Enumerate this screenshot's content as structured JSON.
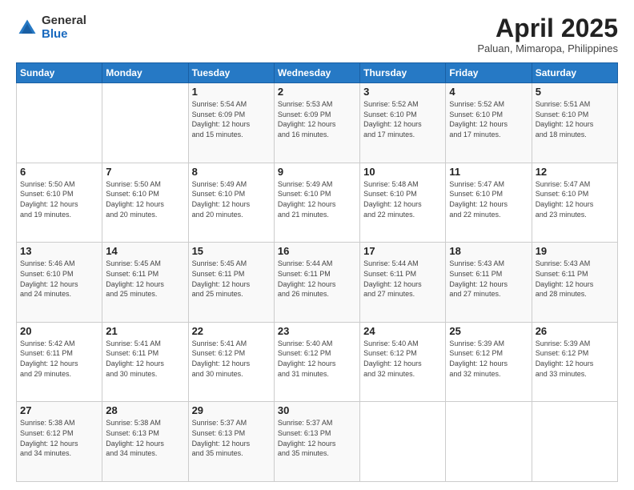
{
  "header": {
    "logo_general": "General",
    "logo_blue": "Blue",
    "month_year": "April 2025",
    "location": "Paluan, Mimaropa, Philippines"
  },
  "days_of_week": [
    "Sunday",
    "Monday",
    "Tuesday",
    "Wednesday",
    "Thursday",
    "Friday",
    "Saturday"
  ],
  "weeks": [
    [
      {
        "day": "",
        "info": ""
      },
      {
        "day": "",
        "info": ""
      },
      {
        "day": "1",
        "info": "Sunrise: 5:54 AM\nSunset: 6:09 PM\nDaylight: 12 hours\nand 15 minutes."
      },
      {
        "day": "2",
        "info": "Sunrise: 5:53 AM\nSunset: 6:09 PM\nDaylight: 12 hours\nand 16 minutes."
      },
      {
        "day": "3",
        "info": "Sunrise: 5:52 AM\nSunset: 6:10 PM\nDaylight: 12 hours\nand 17 minutes."
      },
      {
        "day": "4",
        "info": "Sunrise: 5:52 AM\nSunset: 6:10 PM\nDaylight: 12 hours\nand 17 minutes."
      },
      {
        "day": "5",
        "info": "Sunrise: 5:51 AM\nSunset: 6:10 PM\nDaylight: 12 hours\nand 18 minutes."
      }
    ],
    [
      {
        "day": "6",
        "info": "Sunrise: 5:50 AM\nSunset: 6:10 PM\nDaylight: 12 hours\nand 19 minutes."
      },
      {
        "day": "7",
        "info": "Sunrise: 5:50 AM\nSunset: 6:10 PM\nDaylight: 12 hours\nand 20 minutes."
      },
      {
        "day": "8",
        "info": "Sunrise: 5:49 AM\nSunset: 6:10 PM\nDaylight: 12 hours\nand 20 minutes."
      },
      {
        "day": "9",
        "info": "Sunrise: 5:49 AM\nSunset: 6:10 PM\nDaylight: 12 hours\nand 21 minutes."
      },
      {
        "day": "10",
        "info": "Sunrise: 5:48 AM\nSunset: 6:10 PM\nDaylight: 12 hours\nand 22 minutes."
      },
      {
        "day": "11",
        "info": "Sunrise: 5:47 AM\nSunset: 6:10 PM\nDaylight: 12 hours\nand 22 minutes."
      },
      {
        "day": "12",
        "info": "Sunrise: 5:47 AM\nSunset: 6:10 PM\nDaylight: 12 hours\nand 23 minutes."
      }
    ],
    [
      {
        "day": "13",
        "info": "Sunrise: 5:46 AM\nSunset: 6:10 PM\nDaylight: 12 hours\nand 24 minutes."
      },
      {
        "day": "14",
        "info": "Sunrise: 5:45 AM\nSunset: 6:11 PM\nDaylight: 12 hours\nand 25 minutes."
      },
      {
        "day": "15",
        "info": "Sunrise: 5:45 AM\nSunset: 6:11 PM\nDaylight: 12 hours\nand 25 minutes."
      },
      {
        "day": "16",
        "info": "Sunrise: 5:44 AM\nSunset: 6:11 PM\nDaylight: 12 hours\nand 26 minutes."
      },
      {
        "day": "17",
        "info": "Sunrise: 5:44 AM\nSunset: 6:11 PM\nDaylight: 12 hours\nand 27 minutes."
      },
      {
        "day": "18",
        "info": "Sunrise: 5:43 AM\nSunset: 6:11 PM\nDaylight: 12 hours\nand 27 minutes."
      },
      {
        "day": "19",
        "info": "Sunrise: 5:43 AM\nSunset: 6:11 PM\nDaylight: 12 hours\nand 28 minutes."
      }
    ],
    [
      {
        "day": "20",
        "info": "Sunrise: 5:42 AM\nSunset: 6:11 PM\nDaylight: 12 hours\nand 29 minutes."
      },
      {
        "day": "21",
        "info": "Sunrise: 5:41 AM\nSunset: 6:11 PM\nDaylight: 12 hours\nand 30 minutes."
      },
      {
        "day": "22",
        "info": "Sunrise: 5:41 AM\nSunset: 6:12 PM\nDaylight: 12 hours\nand 30 minutes."
      },
      {
        "day": "23",
        "info": "Sunrise: 5:40 AM\nSunset: 6:12 PM\nDaylight: 12 hours\nand 31 minutes."
      },
      {
        "day": "24",
        "info": "Sunrise: 5:40 AM\nSunset: 6:12 PM\nDaylight: 12 hours\nand 32 minutes."
      },
      {
        "day": "25",
        "info": "Sunrise: 5:39 AM\nSunset: 6:12 PM\nDaylight: 12 hours\nand 32 minutes."
      },
      {
        "day": "26",
        "info": "Sunrise: 5:39 AM\nSunset: 6:12 PM\nDaylight: 12 hours\nand 33 minutes."
      }
    ],
    [
      {
        "day": "27",
        "info": "Sunrise: 5:38 AM\nSunset: 6:12 PM\nDaylight: 12 hours\nand 34 minutes."
      },
      {
        "day": "28",
        "info": "Sunrise: 5:38 AM\nSunset: 6:13 PM\nDaylight: 12 hours\nand 34 minutes."
      },
      {
        "day": "29",
        "info": "Sunrise: 5:37 AM\nSunset: 6:13 PM\nDaylight: 12 hours\nand 35 minutes."
      },
      {
        "day": "30",
        "info": "Sunrise: 5:37 AM\nSunset: 6:13 PM\nDaylight: 12 hours\nand 35 minutes."
      },
      {
        "day": "",
        "info": ""
      },
      {
        "day": "",
        "info": ""
      },
      {
        "day": "",
        "info": ""
      }
    ]
  ]
}
